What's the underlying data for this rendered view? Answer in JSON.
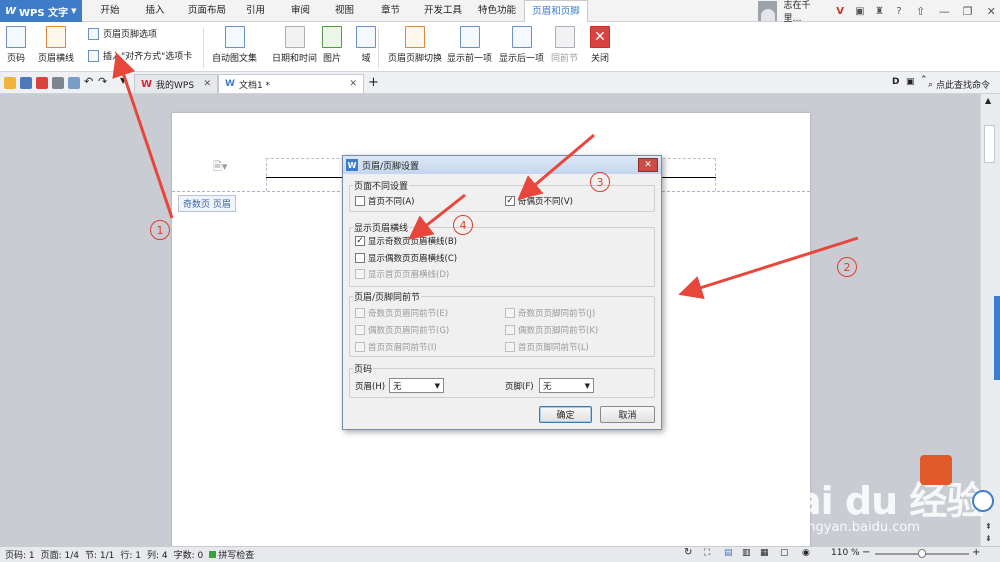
{
  "menu": {
    "app_button": "WPS 文字",
    "tabs": [
      "开始",
      "插入",
      "页面布局",
      "引用",
      "审阅",
      "视图",
      "章节",
      "开发工具",
      "特色功能",
      "页眉和页脚"
    ],
    "active_tab": "页眉和页脚",
    "user_name": "志在千里…"
  },
  "ribbon": {
    "page_number": "页码",
    "header_line": "页眉横线",
    "hf_options": "页眉页脚选项",
    "insert_align_tab": "插入\"对齐方式\"选项卡",
    "auto_text": "自动图文集",
    "date_time": "日期和时间",
    "picture": "图片",
    "field": "域",
    "hf_switch": "页眉页脚切换",
    "show_prev": "显示前一项",
    "show_next": "显示后一项",
    "same_as_prev": "同前节",
    "close": "关闭",
    "close_glyph": "✕"
  },
  "tabbar": {
    "my_wps": "我的WPS",
    "doc_tab": "文档1 *",
    "search_cmd": "点此查找命令",
    "new_tab": "+"
  },
  "document": {
    "odd_page_header_label": "奇数页 页眉"
  },
  "dialog": {
    "title": "页眉/页脚设置",
    "group_diff": "页面不同设置",
    "first_page_diff": "首页不同(A)",
    "odd_even_diff": "奇偶页不同(V)",
    "group_show_line": "显示页眉横线",
    "show_odd_line": "显示奇数页页眉横线(B)",
    "show_even_line": "显示偶数页页眉横线(C)",
    "show_first_line": "显示首页页眉横线(D)",
    "group_same": "页眉/页脚同前节",
    "odd_header_same": "奇数页页眉同前节(E)",
    "odd_footer_same": "奇数页页脚同前节(J)",
    "even_header_same": "偶数页页眉同前节(G)",
    "even_footer_same": "偶数页页脚同前节(K)",
    "first_header_same": "首页页眉同前节(I)",
    "first_footer_same": "首页页脚同前节(L)",
    "group_page_num": "页码",
    "header_label": "页眉(H)",
    "header_value": "无",
    "footer_label": "页脚(F)",
    "footer_value": "无",
    "ok": "确定",
    "cancel": "取消"
  },
  "annotations": [
    "1",
    "2",
    "3",
    "4"
  ],
  "status": {
    "page_num": "页码: 1",
    "page_total": "页面: 1/4",
    "section": "节: 1/1",
    "row": "行: 1",
    "col": "列: 4",
    "chars": "字数: 0",
    "spell": "拼写检查",
    "zoom": "110 %"
  },
  "watermark": {
    "text": "Bai du 经验",
    "url": "jingyan.baidu.com"
  },
  "colors": {
    "accent": "#3f7cc7",
    "annotation_red": "#e03c31"
  }
}
